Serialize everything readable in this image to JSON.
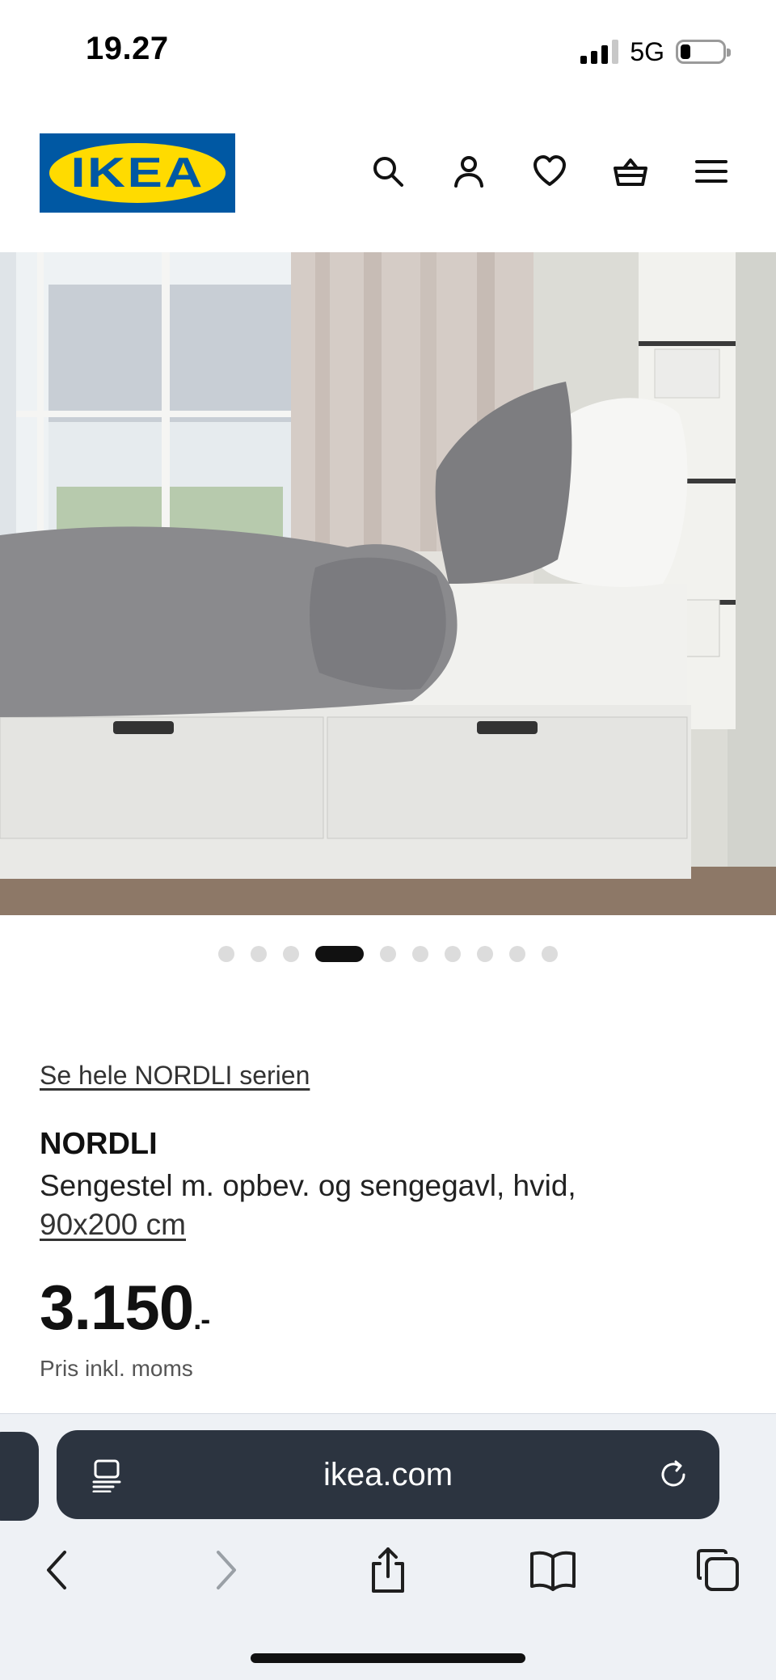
{
  "status": {
    "time": "19.27",
    "network": "5G",
    "signal_bars_active": 3,
    "battery_level": 0.18
  },
  "header": {
    "logo_text": "IKEA",
    "brand_colors": {
      "blue": "#0058a3",
      "yellow": "#ffdb00"
    },
    "icons": [
      "search-icon",
      "account-icon",
      "wishlist-icon",
      "basket-icon",
      "menu-icon"
    ]
  },
  "gallery": {
    "total_images": 10,
    "active_index": 3
  },
  "product": {
    "series_link": "Se hele NORDLI serien",
    "name": "NORDLI",
    "description": "Sengestel m. opbev. og sengegavl, hvid,",
    "size": "90x200 cm",
    "price": "3.150",
    "price_suffix": ".-",
    "price_note": "Pris inkl. moms"
  },
  "browser": {
    "url": "ikea.com",
    "toolbar_icons": [
      "back-icon",
      "forward-icon",
      "share-icon",
      "bookmarks-icon",
      "tabs-icon"
    ]
  }
}
